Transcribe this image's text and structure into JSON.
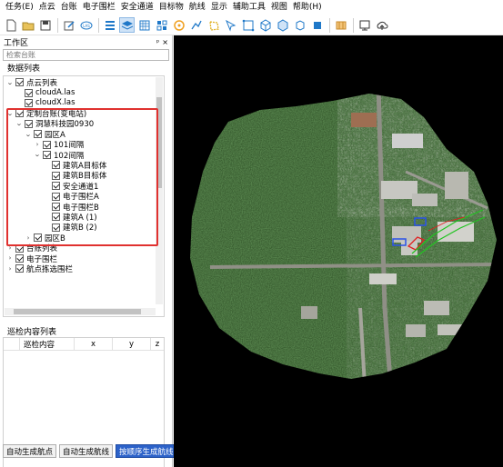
{
  "menu": [
    "任务(E)",
    "点云",
    "台账",
    "电子围栏",
    "安全通道",
    "目标物",
    "航线",
    "显示",
    "辅助工具",
    "视图",
    "帮助(H)"
  ],
  "toolbar_icons": [
    "new-file-icon",
    "open-folder-icon",
    "save-icon",
    "edit-icon",
    "las-file-icon",
    "list-icon",
    "layers-icon",
    "grid-icon",
    "tiles-icon",
    "target-icon",
    "route-icon",
    "polygon-icon",
    "select-icon",
    "node-icon",
    "cube-view-icon",
    "cube-alt-icon",
    "box-icon",
    "solid-box-icon",
    "import-icon",
    "screen-icon",
    "upload-cloud-icon"
  ],
  "panel": {
    "title": "工作区",
    "pin": "ᵖ",
    "close": "×",
    "search_placeholder": "检索台账",
    "data_list_title": "数据列表"
  },
  "tree": [
    {
      "label": "点云列表",
      "level": 0,
      "expander": "v",
      "checked": true
    },
    {
      "label": "cloudA.las",
      "level": 1,
      "expander": "",
      "checked": true
    },
    {
      "label": "cloudX.las",
      "level": 1,
      "expander": "",
      "checked": true
    },
    {
      "label": "定制台账(变电站)",
      "level": 0,
      "expander": "v",
      "checked": true
    },
    {
      "label": "洞慧科技园0930",
      "level": 1,
      "expander": "v",
      "checked": true
    },
    {
      "label": "园区A",
      "level": 2,
      "expander": "v",
      "checked": true
    },
    {
      "label": "101间隔",
      "level": 3,
      "expander": ">",
      "checked": true
    },
    {
      "label": "102间隔",
      "level": 3,
      "expander": "v",
      "checked": true
    },
    {
      "label": "建筑A目标体",
      "level": 4,
      "expander": "",
      "checked": true
    },
    {
      "label": "建筑B目标体",
      "level": 4,
      "expander": "",
      "checked": true
    },
    {
      "label": "安全通道1",
      "level": 4,
      "expander": "",
      "checked": true
    },
    {
      "label": "电子围栏A",
      "level": 4,
      "expander": "",
      "checked": true
    },
    {
      "label": "电子围栏B",
      "level": 4,
      "expander": "",
      "checked": true
    },
    {
      "label": "建筑A (1)",
      "level": 4,
      "expander": "",
      "checked": true
    },
    {
      "label": "建筑B (2)",
      "level": 4,
      "expander": "",
      "checked": true
    },
    {
      "label": "园区B",
      "level": 2,
      "expander": ">",
      "checked": true
    },
    {
      "label": "台账列表",
      "level": 0,
      "expander": ">",
      "checked": true
    },
    {
      "label": "电子围栏",
      "level": 0,
      "expander": ">",
      "checked": true
    },
    {
      "label": "航点拣选围栏",
      "level": 0,
      "expander": ">",
      "checked": true
    }
  ],
  "inspection": {
    "title": "巡检内容列表",
    "columns": [
      "巡检内容",
      "x",
      "y",
      "z"
    ]
  },
  "buttons": {
    "auto_waypoint": "自动生成航点",
    "auto_route": "自动生成航线",
    "ordered_route": "按顺序生成航线"
  },
  "colors": {
    "highlight": "#e0312f",
    "primary_button": "#2c62c9",
    "fence_blue": "#2a52e8",
    "fence_red": "#e02020",
    "route_green": "#22c422",
    "toolbar_accent": "#1f78c8"
  }
}
